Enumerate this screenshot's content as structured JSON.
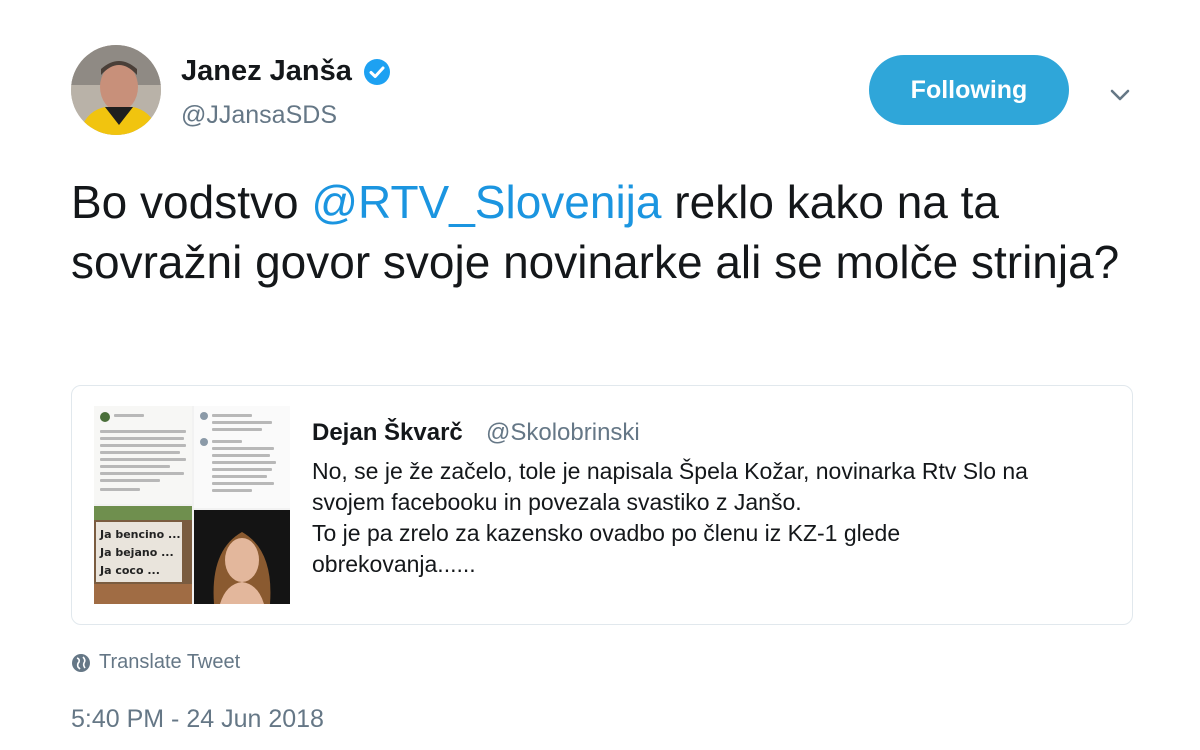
{
  "author": {
    "name": "Janez Janša",
    "handle": "@JJansaSDS",
    "verified": true
  },
  "follow_button": {
    "label": "Following"
  },
  "menu": {
    "icon": "chevron-down-icon"
  },
  "tweet": {
    "text_before": "Bo vodstvo ",
    "mention": "@RTV_Slovenija",
    "text_after": " reklo kako na ta sovražni govor svoje novinarke ali se molče strinja?"
  },
  "quoted_tweet": {
    "name": "Dejan Škvarč",
    "handle": "@Skolobrinski",
    "lines": [
      "No, se je že začelo, tole je napisala Špela Kožar, novinarka Rtv Slo na",
      "svojem facebooku in povezala svastiko z Janšo.",
      "To je pa zrelo za kazensko ovadbo po členu iz KZ-1 glede",
      "obrekovanja......"
    ],
    "media_text": [
      "Ja bencino ...",
      "Ja bejano ...",
      "Ja coco ..."
    ]
  },
  "translate_label": "Translate Tweet",
  "timestamp": "5:40 PM - 24 Jun 2018",
  "colors": {
    "accent": "#1b95e0",
    "follow_bg": "#2fa6d9",
    "secondary_text": "#657786",
    "border": "#e1e8ed"
  }
}
